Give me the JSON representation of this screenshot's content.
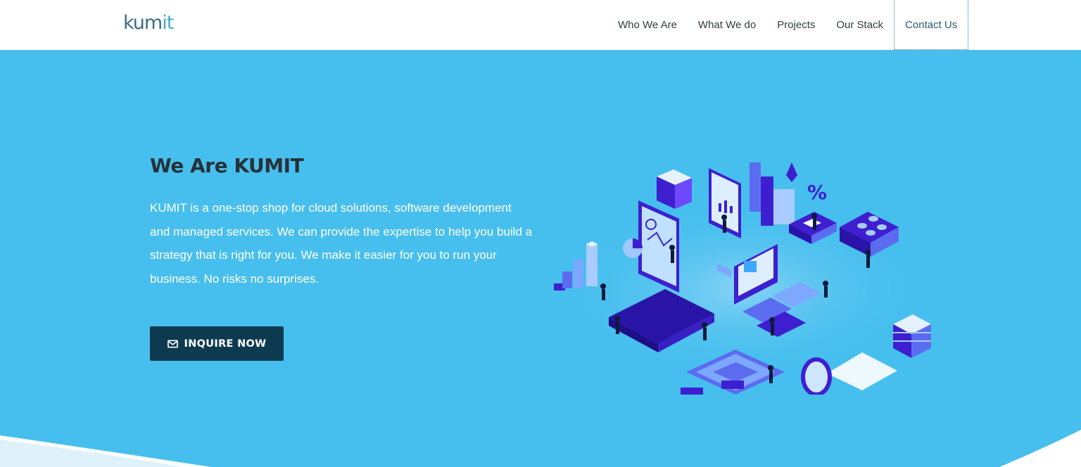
{
  "brand": {
    "logo_main": "kum",
    "logo_accent": "it"
  },
  "nav": {
    "items": [
      {
        "label": "Who We Are"
      },
      {
        "label": "What We do"
      },
      {
        "label": "Projects"
      },
      {
        "label": "Our Stack"
      },
      {
        "label": "Contact Us"
      }
    ]
  },
  "hero": {
    "title": "We Are KUMIT",
    "text": "KUMIT is a one-stop shop for cloud solutions, software development and managed services. We can provide the expertise to help you build a strategy that is right for you. We make it easier for you to run your business. No risks no surprises.",
    "button_label": "INQUIRE NOW",
    "button_icon": "envelope-icon",
    "illustration": "isometric-tech-illustration"
  },
  "colors": {
    "hero_bg": "#47bfee",
    "button_bg": "#0e3a50",
    "title": "#263238",
    "illustration_purple": "#3d1fd0",
    "illustration_light": "#cfe6ff"
  }
}
